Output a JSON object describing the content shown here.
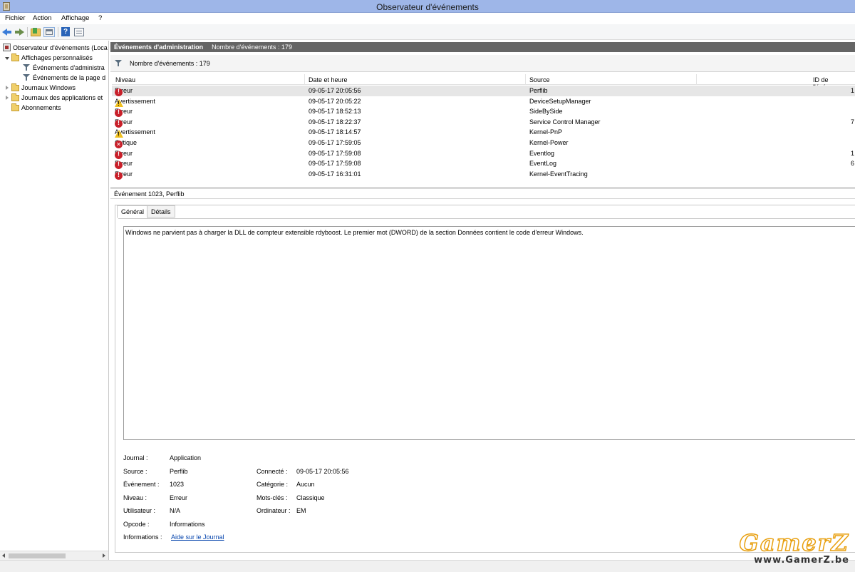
{
  "window": {
    "title": "Observateur d'événements"
  },
  "menu": [
    "Fichier",
    "Action",
    "Affichage",
    "?"
  ],
  "toolbar": {
    "icons": [
      "back-arrow-icon",
      "forward-arrow-icon",
      "folder-up-icon",
      "show-hide-tree-icon",
      "help-icon",
      "properties-icon"
    ]
  },
  "tree": {
    "root": "Observateur d'événements (Loca",
    "custom_views": "Affichages personnalisés",
    "admin_events": "Événements d'administra",
    "summary_events": "Événements de la page d",
    "windows_logs": "Journaux Windows",
    "app_logs": "Journaux des applications et",
    "subscriptions": "Abonnements"
  },
  "main": {
    "header_title": "Événements d'administration",
    "header_count": "Nombre d'événements : 179",
    "filter_count": "Nombre d'événements : 179"
  },
  "grid": {
    "columns": {
      "level": "Niveau",
      "date": "Date et heure",
      "source": "Source",
      "id": "ID de l'événem"
    },
    "rows": [
      {
        "level": "Erreur",
        "type": "error",
        "date": "09-05-17 20:05:56",
        "source": "Perflib",
        "id": "1"
      },
      {
        "level": "Avertissement",
        "type": "warning",
        "date": "09-05-17 20:05:22",
        "source": "DeviceSetupManager",
        "id": ""
      },
      {
        "level": "Erreur",
        "type": "error",
        "date": "09-05-17 18:52:13",
        "source": "SideBySide",
        "id": ""
      },
      {
        "level": "Erreur",
        "type": "error",
        "date": "09-05-17 18:22:37",
        "source": "Service Control Manager",
        "id": "7"
      },
      {
        "level": "Avertissement",
        "type": "warning",
        "date": "09-05-17 18:14:57",
        "source": "Kernel-PnP",
        "id": ""
      },
      {
        "level": "Critique",
        "type": "critical",
        "date": "09-05-17 17:59:05",
        "source": "Kernel-Power",
        "id": ""
      },
      {
        "level": "Erreur",
        "type": "error",
        "date": "09-05-17 17:59:08",
        "source": "Eventlog",
        "id": "1"
      },
      {
        "level": "Erreur",
        "type": "error",
        "date": "09-05-17 17:59:08",
        "source": "EventLog",
        "id": "6"
      },
      {
        "level": "Erreur",
        "type": "error",
        "date": "09-05-17 16:31:01",
        "source": "Kernel-EventTracing",
        "id": ""
      }
    ]
  },
  "detail": {
    "title": "Événement 1023, Perflib",
    "tab_general": "Général",
    "tab_details": "Détails",
    "description": "Windows ne parvient pas à charger la DLL de compteur extensible rdyboost. Le premier mot (DWORD) de la section Données contient le code d'erreur Windows.",
    "props": {
      "journal_label": "Journal :",
      "journal_value": "Application",
      "source_label": "Source :",
      "source_value": "Perflib",
      "event_label": "Événement :",
      "event_value": "1023",
      "level_label": "Niveau :",
      "level_value": "Erreur",
      "user_label": "Utilisateur :",
      "user_value": "N/A",
      "opcode_label": "Opcode :",
      "opcode_value": "Informations",
      "info_label": "Informations :",
      "info_link": "Aide sur le Journal",
      "logged_label": "Connecté :",
      "logged_value": "09-05-17 20:05:56",
      "category_label": "Catégorie :",
      "category_value": "Aucun",
      "keywords_label": "Mots-clés :",
      "keywords_value": "Classique",
      "computer_label": "Ordinateur :",
      "computer_value": "EM"
    }
  },
  "watermark": {
    "logo": "GamerZ",
    "url": "www.GamerZ.be"
  }
}
